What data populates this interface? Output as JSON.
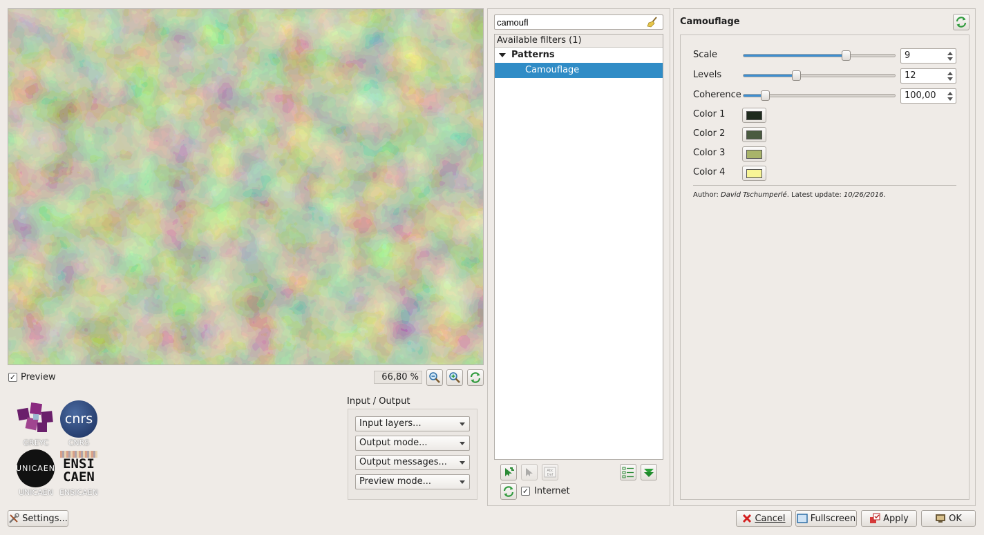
{
  "preview": {
    "checkbox_label": "Preview",
    "checked": true,
    "zoom": "66,80 %"
  },
  "logos": {
    "greyc": "GREYC",
    "cnrs": "CNRS",
    "unicaen": "UNICAEN",
    "ensicaen": "ENSICAEN"
  },
  "io": {
    "title": "Input / Output",
    "input_layers": "Input layers...",
    "output_mode": "Output mode...",
    "output_messages": "Output messages...",
    "preview_mode": "Preview mode..."
  },
  "filters": {
    "search_value": "camoufl",
    "header": "Available filters (1)",
    "group": "Patterns",
    "selected_item": "Camouflage",
    "internet_label": "Internet",
    "internet_checked": true
  },
  "params": {
    "title": "Camouflage",
    "scale": {
      "label": "Scale",
      "value": "9",
      "fraction": 0.69
    },
    "levels": {
      "label": "Levels",
      "value": "12",
      "fraction": 0.34
    },
    "coherence": {
      "label": "Coherence",
      "value": "100,00",
      "fraction": 0.12
    },
    "colors": [
      {
        "label": "Color 1",
        "hex": "#1f2b1e"
      },
      {
        "label": "Color 2",
        "hex": "#4a5a40"
      },
      {
        "label": "Color 3",
        "hex": "#a9b46a"
      },
      {
        "label": "Color 4",
        "hex": "#f8f596"
      }
    ],
    "author_prefix": "Author: ",
    "author_name": "David Tschumperlé",
    "update_prefix": ". Latest update: ",
    "update_date": "10/26/2016",
    "update_suffix": "."
  },
  "buttons": {
    "settings": "Settings...",
    "cancel": "Cancel",
    "fullscreen": "Fullscreen",
    "apply": "Apply",
    "ok": "OK"
  }
}
